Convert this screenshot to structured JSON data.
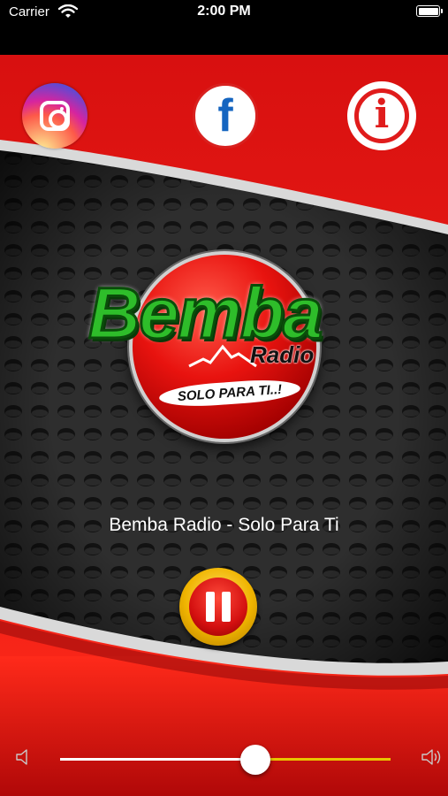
{
  "status_bar": {
    "carrier": "Carrier",
    "time": "2:00 PM"
  },
  "icons": {
    "instagram": "instagram-icon",
    "facebook": "facebook-icon",
    "info": "info-icon",
    "pause": "pause-icon",
    "volume_low": "volume-low-icon",
    "volume_high": "volume-high-icon"
  },
  "header": {
    "facebook_glyph": "f",
    "info_glyph": "i"
  },
  "logo": {
    "name": "Bemba",
    "sub": "Radio",
    "slogan": "SOLO PARA TI..!"
  },
  "player": {
    "station_title": "Bemba Radio - Solo Para Ti",
    "state": "playing"
  },
  "volume": {
    "level": 0.59
  },
  "colors": {
    "primary_red": "#e01c1c",
    "accent_yellow": "#e8c400",
    "dark_panel": "#2a2a2a"
  }
}
